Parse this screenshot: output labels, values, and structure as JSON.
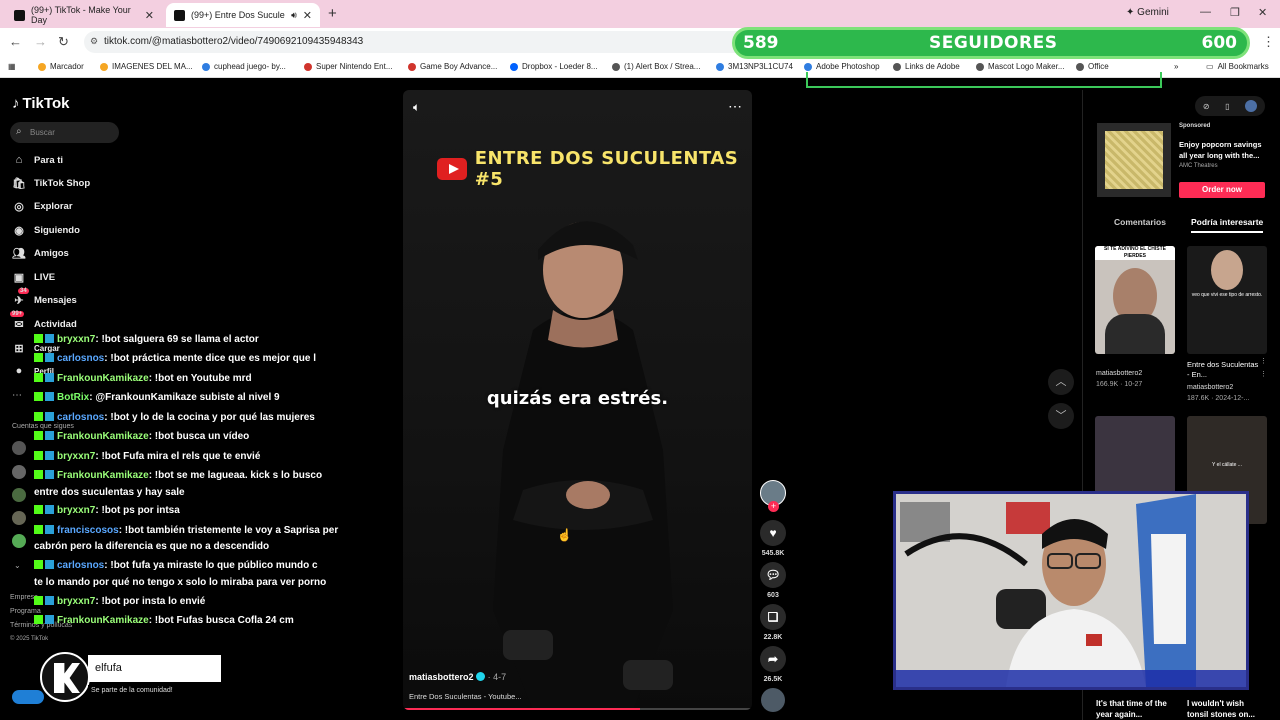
{
  "browser": {
    "tabs": [
      {
        "title": "(99+) TikTok - Make Your Day"
      },
      {
        "title": "(99+) Entre Dos Suculentas"
      }
    ],
    "gemini_label": "Gemini",
    "url": "tiktok.com/@matiasbottero2/video/7490692109435948343",
    "bookmarks": [
      "Marcador",
      "IMAGENES DEL MA...",
      "cuphead juego- by...",
      "Super Nintendo Ent...",
      "Game Boy Advance...",
      "Dropbox - Loeder 8...",
      "(1) Alert Box / Strea...",
      "3M13NP3L1CU74",
      "Adobe Photoshop",
      "Links de Adobe",
      "Mascot Logo Maker...",
      "Office"
    ],
    "all_bookmarks": "All Bookmarks"
  },
  "followers_overlay": {
    "current": "589",
    "label": "SEGUIDORES",
    "goal": "600"
  },
  "sidebar": {
    "logo": "TikTok",
    "search_placeholder": "Buscar",
    "nav": [
      {
        "label": "Para ti",
        "icon": "home-icon"
      },
      {
        "label": "TikTok Shop",
        "icon": "shop-icon"
      },
      {
        "label": "Explorar",
        "icon": "compass-icon"
      },
      {
        "label": "Siguiendo",
        "icon": "following-icon"
      },
      {
        "label": "Amigos",
        "icon": "friends-icon"
      },
      {
        "label": "LIVE",
        "icon": "live-icon"
      },
      {
        "label": "Mensajes",
        "icon": "messages-icon",
        "badge": "34"
      },
      {
        "label": "Actividad",
        "icon": "activity-icon",
        "badge": "99+"
      },
      {
        "label": "Cargar",
        "icon": "upload-icon"
      },
      {
        "label": "Perfil",
        "icon": "profile-icon"
      }
    ],
    "following_header": "Cuentas que sigues",
    "footer": [
      "Empresa",
      "Programa",
      "Términos y políticas",
      "© 2025 TikTok"
    ]
  },
  "chat": [
    {
      "user": "bryxxn7",
      "color": "green",
      "text": ": !bot salguera 69 se llama el actor"
    },
    {
      "user": "carlosnos",
      "color": "blue",
      "text": ": !bot práctica mente dice que es mejor que l"
    },
    {
      "user": "FrankounKamikaze",
      "color": "green",
      "text": ": !bot en Youtube mrd"
    },
    {
      "user": "BotRix",
      "color": "botrix",
      "text": ": @FrankounKamikaze subiste al nivel 9"
    },
    {
      "user": "carlosnos",
      "color": "blue",
      "text": ": !bot y lo de la cocina y por qué las mujeres"
    },
    {
      "user": "FrankounKamikaze",
      "color": "green",
      "text": ": !bot busca un vídeo"
    },
    {
      "user": "bryxxn7",
      "color": "green",
      "text": ": !bot Fufa mira el rels que te envié"
    },
    {
      "user": "FrankounKamikaze",
      "color": "green",
      "text": ": !bot se me lagueaa. kick s lo busco"
    },
    {
      "user": "",
      "color": "none",
      "text": "entre dos suculentas y hay sale"
    },
    {
      "user": "bryxxn7",
      "color": "green",
      "text": ": !bot ps por intsa"
    },
    {
      "user": "franciscosos",
      "color": "blue",
      "text": ": !bot también tristemente le voy a Saprisa per"
    },
    {
      "user": "",
      "color": "none",
      "text": "cabrón pero la diferencia es que no a descendido"
    },
    {
      "user": "carlosnos",
      "color": "blue",
      "text": ": !bot fufa ya miraste lo que público mundo c"
    },
    {
      "user": "",
      "color": "none",
      "text": "te lo mando por qué no tengo x solo lo miraba para ver porno"
    },
    {
      "user": "bryxxn7",
      "color": "green",
      "text": ": !bot por insta lo envié"
    },
    {
      "user": "FrankounKamikaze",
      "color": "green",
      "text": ": !bot Fufas busca Cofla 24 cm"
    }
  ],
  "kick": {
    "name": "elfufa",
    "subtitle": "Se parte de la comunidad!"
  },
  "video": {
    "title": "ENTRE DOS SUCULENTAS #5",
    "caption": "quizás era estrés.",
    "author": "matiasbottero2",
    "date": "4-7",
    "description": "Entre Dos Suculentas - Youtube...",
    "progress": 0.68,
    "likes": "545.8K",
    "comments": "603",
    "saves": "22.8K",
    "shares": "26.5K"
  },
  "right_panel": {
    "sponsored": "Sponsored",
    "ad_text": "Enjoy popcorn savings all year long with the...",
    "ad_brand": "AMC Theatres",
    "order_button": "Order now",
    "tabs": [
      "Comentarios",
      "Podría interesarte"
    ],
    "cards": [
      {
        "overlay": "SI TE ADIVINO EL CHISTE PIERDES",
        "caption": "",
        "author": "matiasbottero2",
        "meta": "166.9K · 10-27"
      },
      {
        "overlay": "veo que vivi ese tipo de arresto.",
        "caption": "Entre dos Suculentas - En...",
        "author": "matiasbottero2",
        "meta": "187.6K · 2024-12-..."
      },
      {
        "overlay": "",
        "caption": "",
        "author": "",
        "meta": ""
      },
      {
        "overlay": "Y el cállate ...",
        "caption": "",
        "author": "",
        "meta": ""
      }
    ],
    "bottom_captions": [
      "It's that time of the year again...",
      "I wouldn't wish tonsil stones on..."
    ]
  },
  "colors": {
    "tiktok_red": "#fe2c55",
    "follower_green": "#2db84c",
    "kick_green": "#53fc18",
    "caption_yellow": "#f8e46a"
  }
}
